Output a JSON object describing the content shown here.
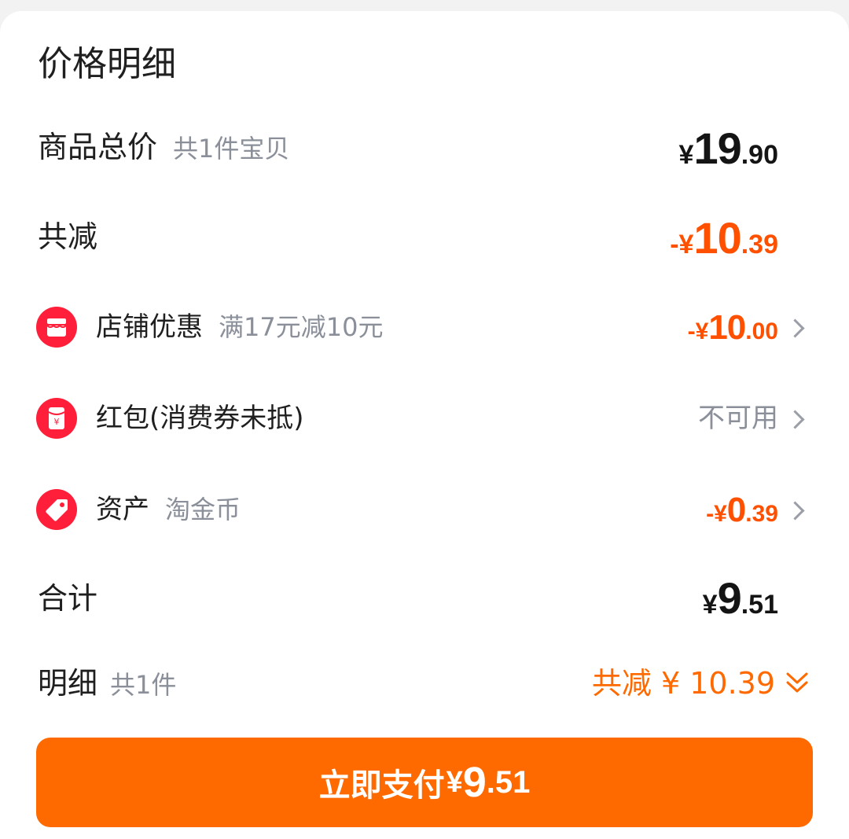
{
  "sheet": {
    "title": "价格明细"
  },
  "goods_total": {
    "label": "商品总价",
    "sub": "共1件宝贝",
    "symbol": "¥",
    "integer": "19",
    "decimal": ".90"
  },
  "total_discount": {
    "label": "共减",
    "prefix": "-",
    "symbol": "¥",
    "integer": "10",
    "decimal": ".39"
  },
  "items": [
    {
      "label": "店铺优惠",
      "sub": "满17元减10元",
      "icon": "shop-icon",
      "prefix": "-",
      "symbol": "¥",
      "integer": "10",
      "decimal": ".00"
    },
    {
      "label": "红包(消费券未抵)",
      "sub": "",
      "icon": "red-envelope-icon",
      "value_text": "不可用"
    },
    {
      "label": "资产",
      "sub": "淘金币",
      "icon": "coin-tag-icon",
      "prefix": "-",
      "symbol": "¥",
      "integer": "0",
      "decimal": ".39"
    }
  ],
  "sum": {
    "label": "合计",
    "symbol": "¥",
    "integer": "9",
    "decimal": ".51"
  },
  "detail": {
    "label": "明细",
    "sub": "共1件",
    "right_text": "共减 ¥ 10.39"
  },
  "pay_button": {
    "label": "立即支付",
    "symbol": "¥",
    "integer": "9",
    "decimal": ".51"
  },
  "colors": {
    "accent": "#ff6a00",
    "discount": "#ff5000",
    "icon_red": "#ff1f3a",
    "muted": "#8a8f99"
  }
}
